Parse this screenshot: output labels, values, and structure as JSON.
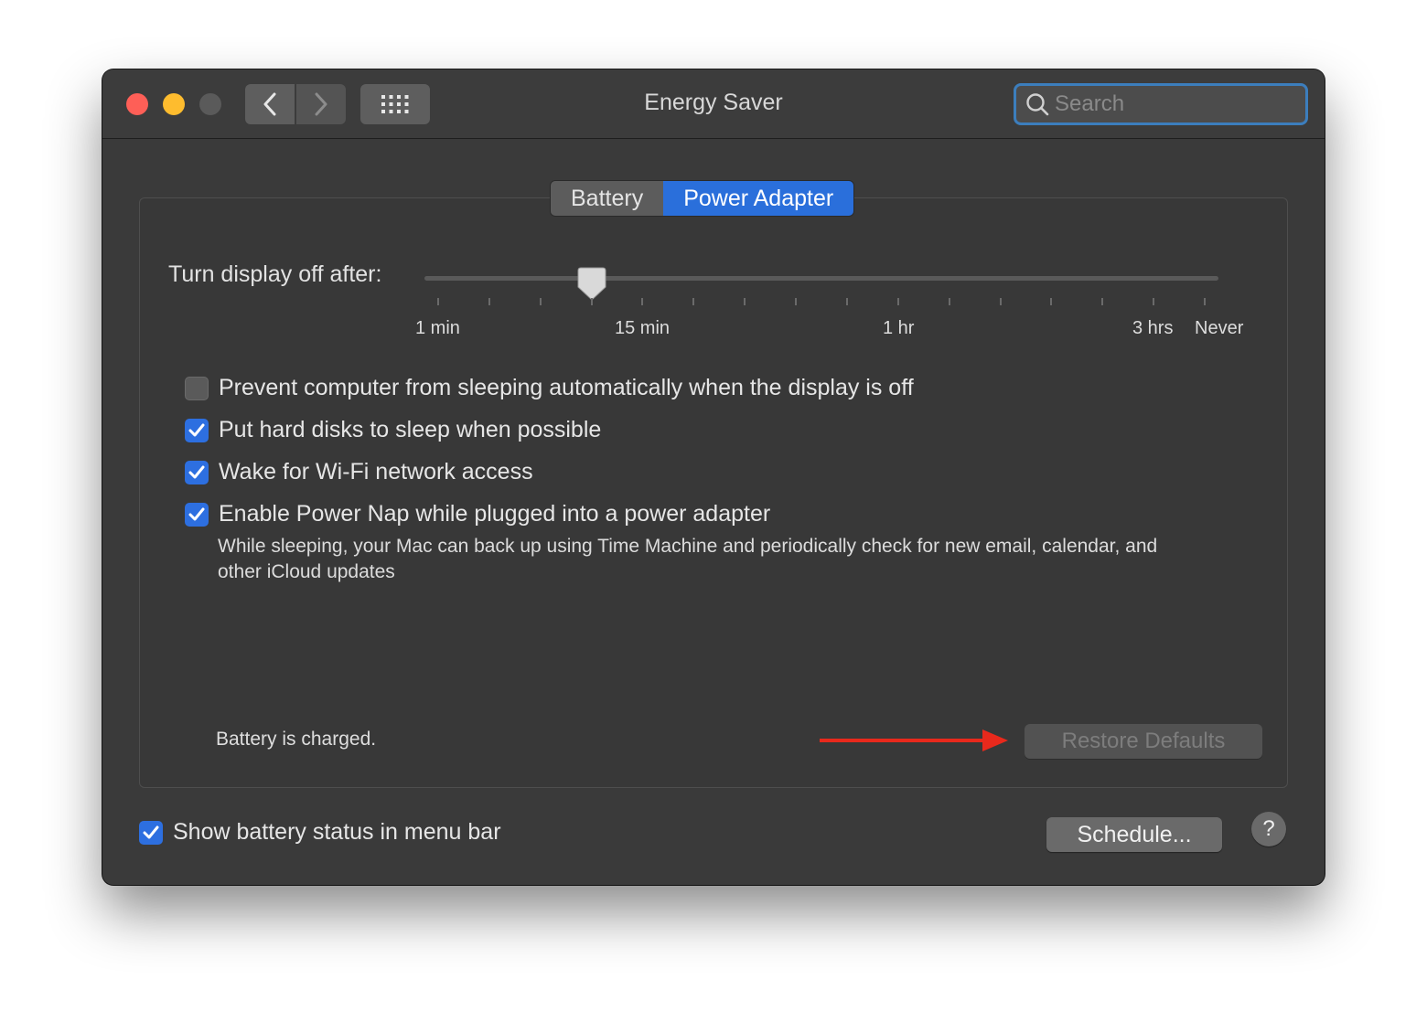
{
  "window": {
    "title": "Energy Saver",
    "search_placeholder": "Search"
  },
  "tabs": [
    {
      "label": "Battery",
      "active": false
    },
    {
      "label": "Power Adapter",
      "active": true
    }
  ],
  "display_slider": {
    "label": "Turn display off after:",
    "selected": "15 min",
    "tick_labels": [
      "1 min",
      "15 min",
      "1 hr",
      "3 hrs",
      "Never"
    ]
  },
  "options": [
    {
      "label": "Prevent computer from sleeping automatically when the display is off",
      "checked": false
    },
    {
      "label": "Put hard disks to sleep when possible",
      "checked": true
    },
    {
      "label": "Wake for Wi-Fi network access",
      "checked": true
    },
    {
      "label": "Enable Power Nap while plugged into a power adapter",
      "checked": true
    }
  ],
  "power_nap_description": "While sleeping, your Mac can back up using Time Machine and periodically check for new email, calendar, and other iCloud updates",
  "battery_status": "Battery is charged.",
  "restore_defaults_label": "Restore Defaults",
  "restore_defaults_enabled": false,
  "show_battery_status": {
    "label": "Show battery status in menu bar",
    "checked": true
  },
  "schedule_label": "Schedule...",
  "help_label": "?",
  "colors": {
    "accent": "#2a6fdb",
    "close": "#fe5f57",
    "minimize": "#febc2e",
    "annotation_arrow": "#e8291c"
  }
}
